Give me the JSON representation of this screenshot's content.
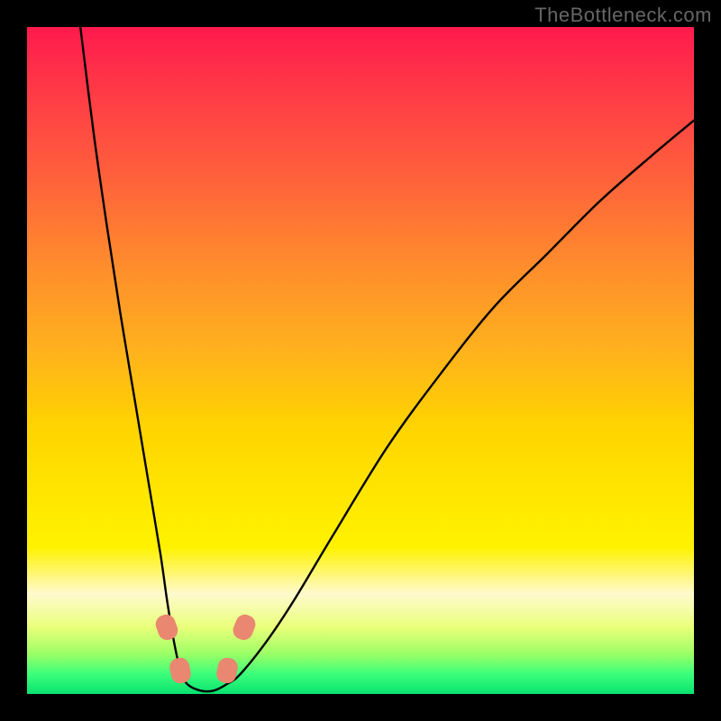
{
  "watermark": "TheBottleneck.com",
  "chart_data": {
    "type": "line",
    "title": "",
    "xlabel": "",
    "ylabel": "",
    "xlim": [
      0,
      100
    ],
    "ylim": [
      0,
      100
    ],
    "series": [
      {
        "name": "curve",
        "x": [
          8,
          10,
          12,
          14,
          16,
          18,
          20,
          21,
          22,
          23,
          24,
          26,
          28,
          30,
          32,
          36,
          40,
          46,
          54,
          62,
          70,
          78,
          86,
          94,
          100
        ],
        "values": [
          100,
          84,
          70,
          57,
          45,
          33,
          21,
          14,
          8,
          3.5,
          1.5,
          0.5,
          0.5,
          1.5,
          3,
          8,
          14,
          24,
          37,
          48,
          58,
          66,
          74,
          81,
          86
        ]
      }
    ],
    "markers": [
      {
        "name": "left-upper",
        "x": 21.0,
        "y": 10.0,
        "rot": -20
      },
      {
        "name": "right-upper",
        "x": 32.5,
        "y": 10.0,
        "rot": 22
      },
      {
        "name": "left-lower",
        "x": 23.0,
        "y": 3.5,
        "rot": -12
      },
      {
        "name": "right-lower",
        "x": 30.0,
        "y": 3.5,
        "rot": 12
      }
    ],
    "colors": {
      "curve": "#000000",
      "marker": "#e98771",
      "background_top": "#ff1a4d",
      "background_bottom": "#09e26f"
    }
  }
}
